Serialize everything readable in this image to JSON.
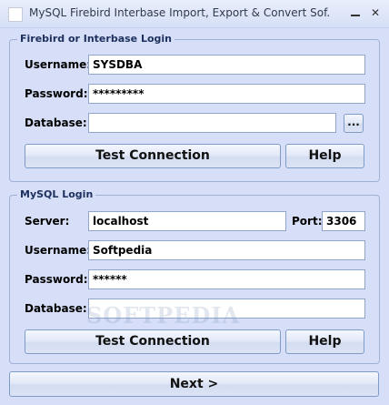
{
  "window": {
    "title": "MySQL Firebird Interbase Import, Export & Convert Sof...",
    "minimize_glyph": "–",
    "close_glyph": "✕"
  },
  "firebird_group": {
    "title": "Firebird or Interbase Login",
    "username_label": "Username:",
    "username_value": "SYSDBA",
    "password_label": "Password:",
    "password_value": "*********",
    "database_label": "Database:",
    "database_value": "",
    "browse_label": "...",
    "test_connection_label": "Test Connection",
    "help_label": "Help"
  },
  "mysql_group": {
    "title": "MySQL Login",
    "server_label": "Server:",
    "server_value": "localhost",
    "port_label": "Port:",
    "port_value": "3306",
    "username_label": "Username:",
    "username_value": "Softpedia",
    "password_label": "Password:",
    "password_value": "******",
    "database_label": "Database:",
    "database_value": "",
    "test_connection_label": "Test Connection",
    "help_label": "Help"
  },
  "footer": {
    "next_label": "Next >"
  },
  "watermark_text": "SOFTPEDIA"
}
